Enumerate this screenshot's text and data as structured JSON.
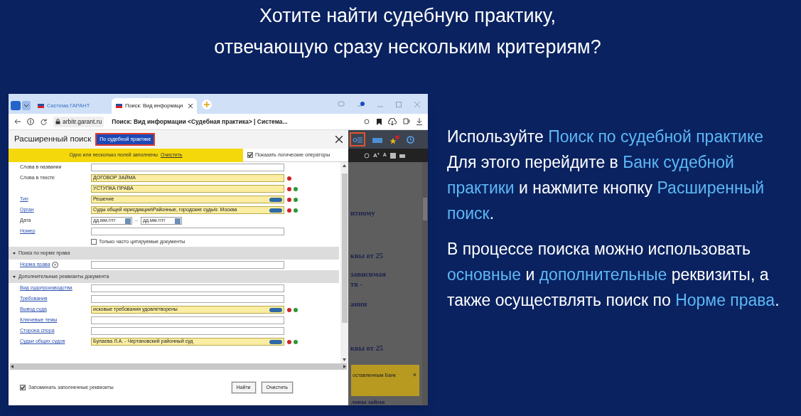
{
  "slide_title": [
    "Хотите найти судебную практику,",
    "отвечающую сразу нескольким критериям?"
  ],
  "browser": {
    "tabs": [
      {
        "label": "Система ГАРАНТ",
        "selected": false
      },
      {
        "label": "Поиск: Вид информаци",
        "selected": true
      }
    ],
    "address": "arbitr.garant.ru",
    "page_title": "Поиск: Вид информации <Судебная практика> | Система..."
  },
  "dialog": {
    "title": "Расширенный поиск",
    "mode_button": "По судебной практике",
    "notice": "Одно или несколько полей заполнены",
    "notice_link": "Очистить",
    "show_operators": {
      "label": "Показать логические операторы",
      "checked": true
    },
    "rows": [
      {
        "kind": "field",
        "label": "Слова в названии",
        "link": false,
        "value": "",
        "filled": false
      },
      {
        "kind": "field",
        "label": "Слова в тексте",
        "link": false,
        "value": "ДОГОВОР ЗАЙМА",
        "filled": true,
        "remove": true
      },
      {
        "kind": "field",
        "value": "УСТУПКА ПРАВА",
        "filled": true,
        "remove": true,
        "add": true
      },
      {
        "kind": "field",
        "label": "Тип",
        "link": true,
        "value": "Решение",
        "filled": true,
        "pill": true,
        "remove": true,
        "add": true
      },
      {
        "kind": "field",
        "label": "Орган",
        "link": true,
        "value": "Суды общей юрисдикции\\Районные, городские суды\\г. Москва",
        "filled": true,
        "pill": true,
        "remove": true,
        "add": true
      },
      {
        "kind": "date",
        "label": "Дата",
        "from": "дд.мм.гггг",
        "separator": "–",
        "to": "дд.мм.гггг"
      },
      {
        "kind": "field",
        "label": "Номер",
        "link": true,
        "value": "",
        "filled": false
      },
      {
        "kind": "checkbox",
        "label": "Только часто цитируемые документы",
        "checked": false
      },
      {
        "kind": "section",
        "label": "Поиск по норме права",
        "expanded": true
      },
      {
        "kind": "field",
        "label": "Норма права",
        "link": true,
        "help": "?",
        "value": "",
        "filled": false
      },
      {
        "kind": "section",
        "label": "Дополнительные реквизиты документа",
        "expanded": true
      },
      {
        "kind": "field",
        "label": "Вид судопроизводства",
        "link": true,
        "value": "",
        "filled": false
      },
      {
        "kind": "field",
        "label": "Требования",
        "link": true,
        "value": "",
        "filled": false
      },
      {
        "kind": "field",
        "label": "Вывод суда",
        "link": true,
        "value": "исковые требования удовлетворены",
        "filled": true,
        "pill": true,
        "remove": true,
        "add": true
      },
      {
        "kind": "field",
        "label": "Ключевые темы",
        "link": true,
        "value": "",
        "filled": false
      },
      {
        "kind": "field",
        "label": "Сторона спора",
        "link": true,
        "value": "",
        "filled": false
      },
      {
        "kind": "field",
        "label": "Судьи общих судов",
        "link": true,
        "value": "Булаева Л.А. - Чертановский районный суд",
        "filled": true,
        "pill": true,
        "remove": true,
        "add": true
      }
    ],
    "remember": {
      "label": "Запоминать заполненные реквизиты",
      "checked": true
    },
    "buttons": [
      "Найти",
      "Очистить"
    ]
  },
  "page": {
    "text_buttons": [
      "A⁺",
      "A"
    ],
    "fragments": [
      "итному",
      "квы от 25",
      "зависимая",
      "тв -",
      "ании",
      "квы от 25"
    ],
    "toast": "оставленным Банк",
    "toast_close": "×",
    "bottom_text": "ловы займа"
  },
  "paragraphs": [
    [
      {
        "text": "Используйте ",
        "highlight": false
      },
      {
        "text": "Поиск по судебной практике",
        "highlight": true
      },
      {
        "text": " Для этого перейдите в ",
        "highlight": false
      },
      {
        "text": "Банк судебной практики",
        "highlight": true
      },
      {
        "text": " и нажмите кнопку ",
        "highlight": false
      },
      {
        "text": "Расширенный поиск",
        "highlight": true
      },
      {
        "text": ".",
        "highlight": false
      }
    ],
    [
      {
        "text": "В процессе поиска можно использовать ",
        "highlight": false
      },
      {
        "text": "основные",
        "highlight": true
      },
      {
        "text": " и ",
        "highlight": false
      },
      {
        "text": "дополнительные",
        "highlight": true
      },
      {
        "text": " реквизиты, а также осуществлять поиск по ",
        "highlight": false
      },
      {
        "text": "Норме права",
        "highlight": true
      },
      {
        "text": ".",
        "highlight": false
      }
    ]
  ]
}
